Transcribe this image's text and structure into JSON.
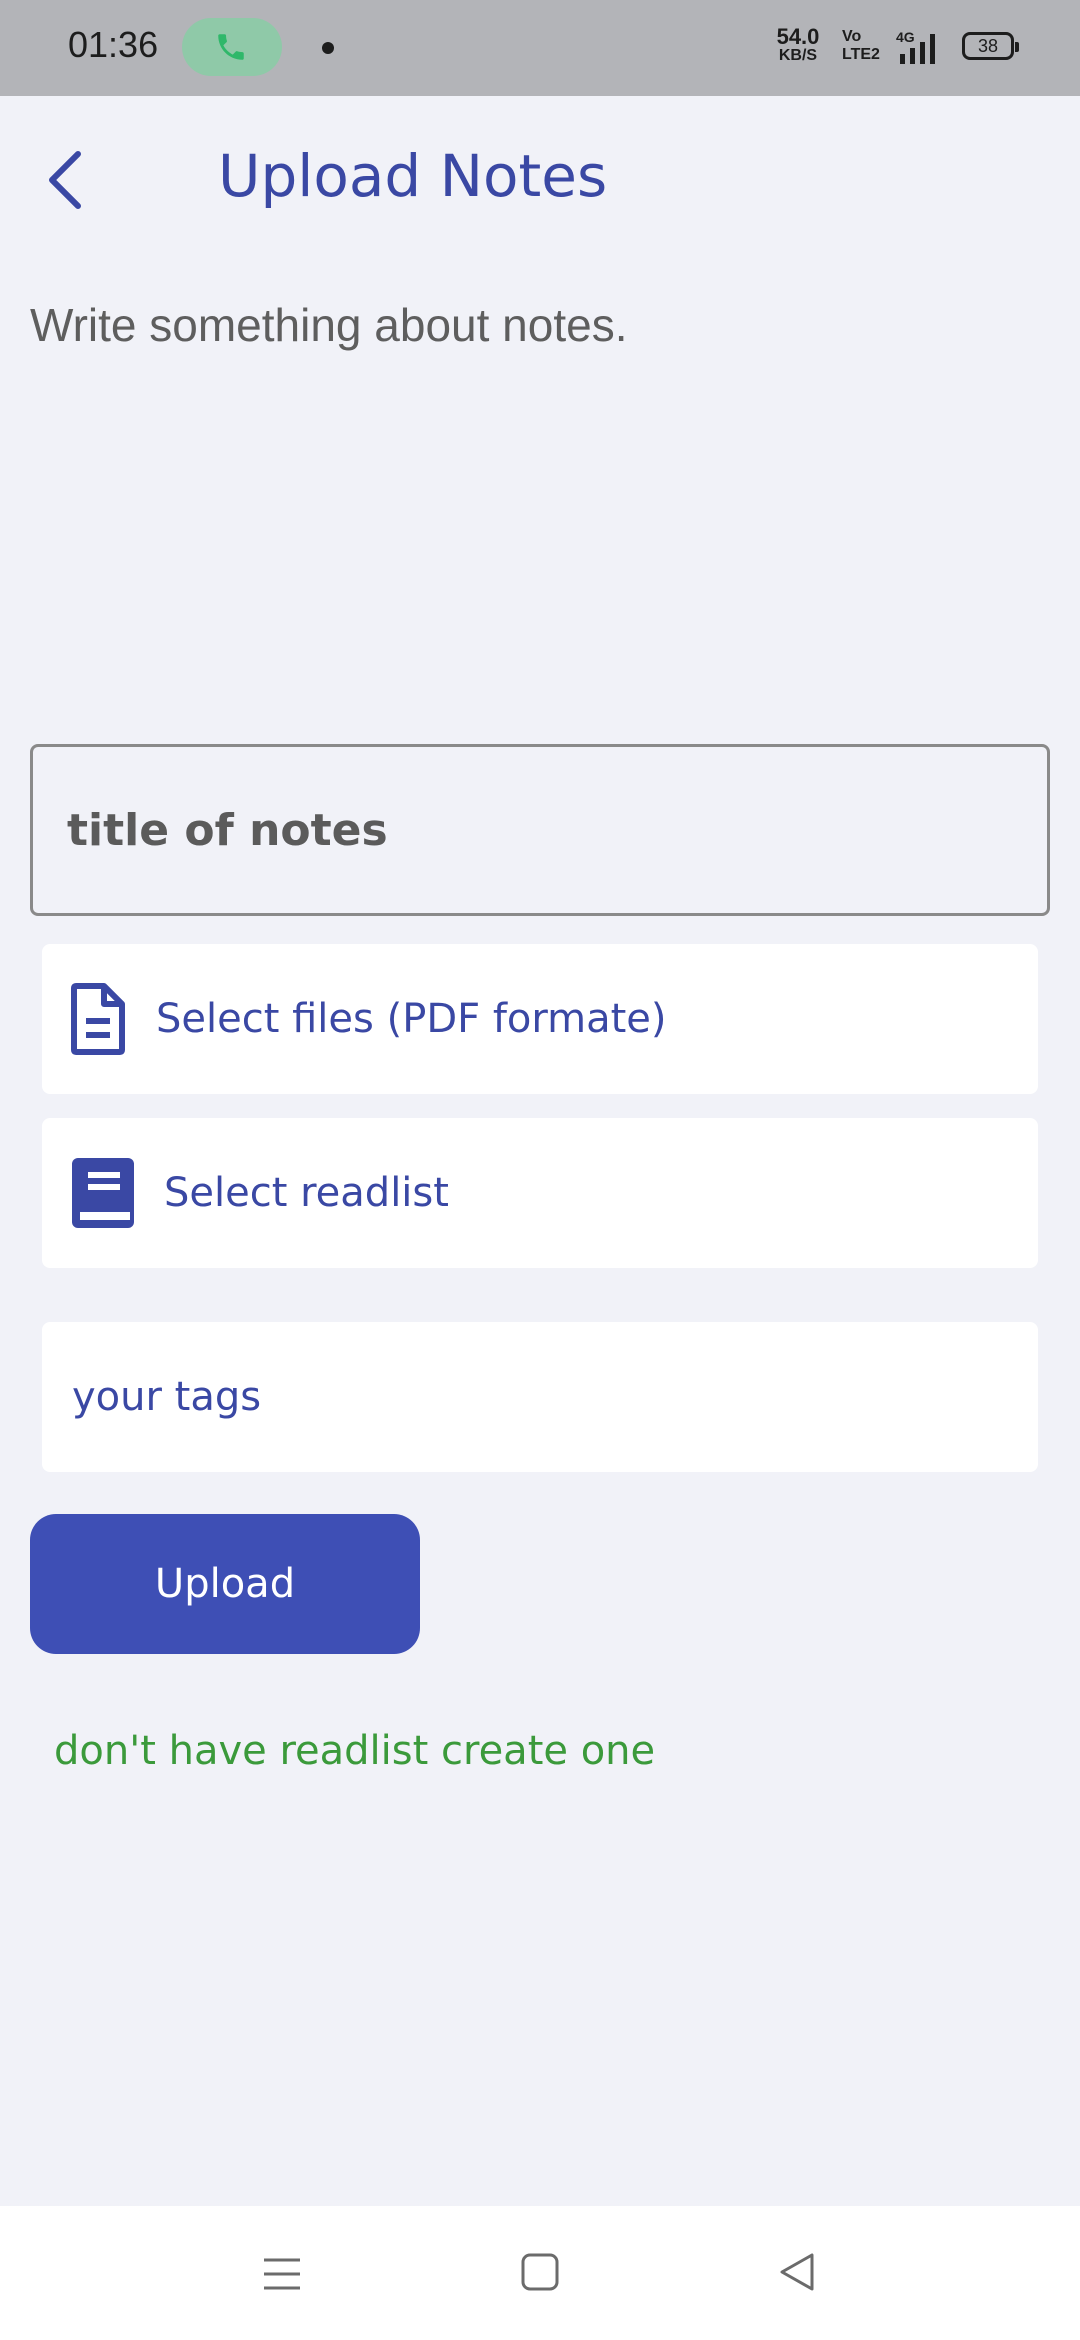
{
  "status_bar": {
    "time": "01:36",
    "net_speed_value": "54.0",
    "net_speed_unit": "KB/S",
    "volte_top": "Vo",
    "volte_bottom": "LTE2",
    "network_type": "4G",
    "battery_level": "38"
  },
  "header": {
    "title": "Upload Notes",
    "back_icon": "chevron-left-icon"
  },
  "description": "Write something about notes.",
  "form": {
    "title_placeholder": "title of notes",
    "file_select_label": "Select files (PDF formate)",
    "file_icon": "file-document-icon",
    "readlist_select_label": "Select readlist",
    "readlist_icon": "book-icon",
    "tags_placeholder": "your tags",
    "upload_label": "Upload",
    "create_readlist_link": "don't have readlist create one"
  },
  "nav_bar": {
    "icons": [
      "menu-icon",
      "home-square-icon",
      "back-triangle-icon"
    ]
  },
  "colors": {
    "accent": "#3a48a4",
    "button": "#3e4fb5",
    "link": "#3b9a3b",
    "background": "#f1f2f8"
  }
}
